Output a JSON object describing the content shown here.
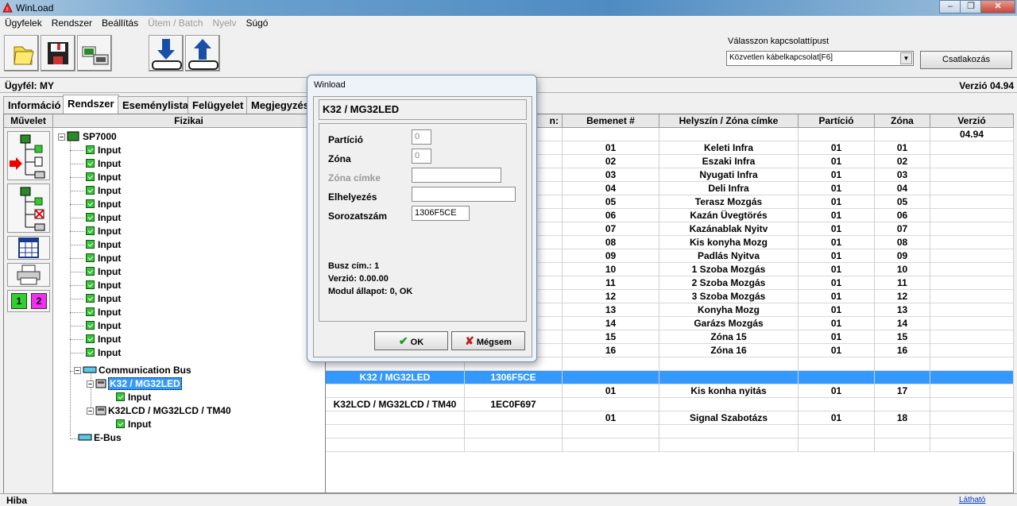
{
  "window": {
    "title": "WinLoad"
  },
  "menu": [
    "Ügyfelek",
    "Rendszer",
    "Beállítás",
    "Ütem / Batch",
    "Nyelv",
    "Súgó"
  ],
  "menu_disabled": [
    false,
    false,
    false,
    true,
    true,
    false
  ],
  "connection": {
    "label": "Válasszon kapcsolattípust",
    "selected": "Közvetlen kábelkapcsolat[F6]",
    "button": "Csatlakozás"
  },
  "info": {
    "client": "Ügyfél: MY",
    "version": "Verzió 04.94"
  },
  "tabs": [
    "Információ",
    "Rendszer",
    "Eseménylista",
    "Felügyelet",
    "Megjegyzés"
  ],
  "columns": {
    "muvelet": "Művelet",
    "fizikai": "Fizikai",
    "hidden": "n:",
    "bemenet": "Bemenet #",
    "helyszin": "Helyszín / Zóna címke",
    "particio": "Partíció",
    "zona": "Zóna",
    "verzio": "Verzió"
  },
  "tree": {
    "root": "SP7000",
    "input": "Input",
    "bus": "Communication Bus",
    "mod1": "K32 / MG32LED",
    "mod2": "K32LCD / MG32LCD / TM40",
    "ebus": "E-Bus"
  },
  "rows": [
    {
      "a": "",
      "b": "",
      "bem": "",
      "hely": "",
      "part": "",
      "zona": "",
      "ver": "04.94"
    },
    {
      "a": "",
      "b": "",
      "bem": "01",
      "hely": "Keleti Infra",
      "part": "01",
      "zona": "01",
      "ver": ""
    },
    {
      "a": "",
      "b": "",
      "bem": "02",
      "hely": "Eszaki Infra",
      "part": "01",
      "zona": "02",
      "ver": ""
    },
    {
      "a": "",
      "b": "",
      "bem": "03",
      "hely": "Nyugati Infra",
      "part": "01",
      "zona": "03",
      "ver": ""
    },
    {
      "a": "",
      "b": "",
      "bem": "04",
      "hely": "Deli Infra",
      "part": "01",
      "zona": "04",
      "ver": ""
    },
    {
      "a": "",
      "b": "",
      "bem": "05",
      "hely": "Terasz Mozgás",
      "part": "01",
      "zona": "05",
      "ver": ""
    },
    {
      "a": "",
      "b": "",
      "bem": "06",
      "hely": "Kazán Üvegtörés",
      "part": "01",
      "zona": "06",
      "ver": ""
    },
    {
      "a": "",
      "b": "",
      "bem": "07",
      "hely": "Kazánablak Nyitv",
      "part": "01",
      "zona": "07",
      "ver": ""
    },
    {
      "a": "",
      "b": "",
      "bem": "08",
      "hely": "Kis konyha Mozg",
      "part": "01",
      "zona": "08",
      "ver": ""
    },
    {
      "a": "",
      "b": "",
      "bem": "09",
      "hely": "Padlás Nyitva",
      "part": "01",
      "zona": "09",
      "ver": ""
    },
    {
      "a": "",
      "b": "",
      "bem": "10",
      "hely": "1 Szoba Mozgás",
      "part": "01",
      "zona": "10",
      "ver": ""
    },
    {
      "a": "",
      "b": "",
      "bem": "11",
      "hely": "2 Szoba Mozgás",
      "part": "01",
      "zona": "11",
      "ver": ""
    },
    {
      "a": "",
      "b": "",
      "bem": "12",
      "hely": "3 Szoba Mozgás",
      "part": "01",
      "zona": "12",
      "ver": ""
    },
    {
      "a": "",
      "b": "",
      "bem": "13",
      "hely": "Konyha Mozg",
      "part": "01",
      "zona": "13",
      "ver": ""
    },
    {
      "a": "",
      "b": "",
      "bem": "14",
      "hely": "Garázs Mozgás",
      "part": "01",
      "zona": "14",
      "ver": ""
    },
    {
      "a": "",
      "b": "",
      "bem": "15",
      "hely": "Zóna 15",
      "part": "01",
      "zona": "15",
      "ver": ""
    },
    {
      "a": "",
      "b": "",
      "bem": "16",
      "hely": "Zóna 16",
      "part": "01",
      "zona": "16",
      "ver": ""
    },
    {
      "a": "",
      "b": "",
      "bem": "",
      "hely": "",
      "part": "",
      "zona": "",
      "ver": ""
    },
    {
      "a": "K32 / MG32LED",
      "b": "1306F5CE",
      "bem": "",
      "hely": "",
      "part": "",
      "zona": "",
      "ver": ""
    },
    {
      "a": "",
      "b": "",
      "bem": "01",
      "hely": "Kis konha nyitás",
      "part": "01",
      "zona": "17",
      "ver": ""
    },
    {
      "a": "K32LCD / MG32LCD / TM40",
      "b": "1EC0F697",
      "bem": "",
      "hely": "",
      "part": "",
      "zona": "",
      "ver": ""
    },
    {
      "a": "",
      "b": "",
      "bem": "01",
      "hely": "Signal Szabotázs",
      "part": "01",
      "zona": "18",
      "ver": ""
    },
    {
      "a": "",
      "b": "",
      "bem": "",
      "hely": "",
      "part": "",
      "zona": "",
      "ver": ""
    },
    {
      "a": "",
      "b": "",
      "bem": "",
      "hely": "",
      "part": "",
      "zona": "",
      "ver": ""
    }
  ],
  "status": {
    "left": "Hiba",
    "right": "Látható"
  },
  "dialog": {
    "title": "Winload",
    "header": "K32 / MG32LED",
    "particio_label": "Partíció",
    "particio": "0",
    "zona_label": "Zóna",
    "zona": "0",
    "cimke_label": "Zóna címke",
    "cimke": "",
    "elhelyezes_label": "Elhelyezés",
    "elhelyezes": "",
    "sorozat_label": "Sorozatszám",
    "sorozat": "1306F5CE",
    "busz": "Busz cím.: 1",
    "verzio": "Verzió: 0.00.00",
    "modul": "Modul állapot: 0,  OK",
    "ok": "OK",
    "cancel": "Mégsem"
  },
  "colors": {
    "selection": "#3399ff",
    "green_icon": "#3ac23a"
  }
}
